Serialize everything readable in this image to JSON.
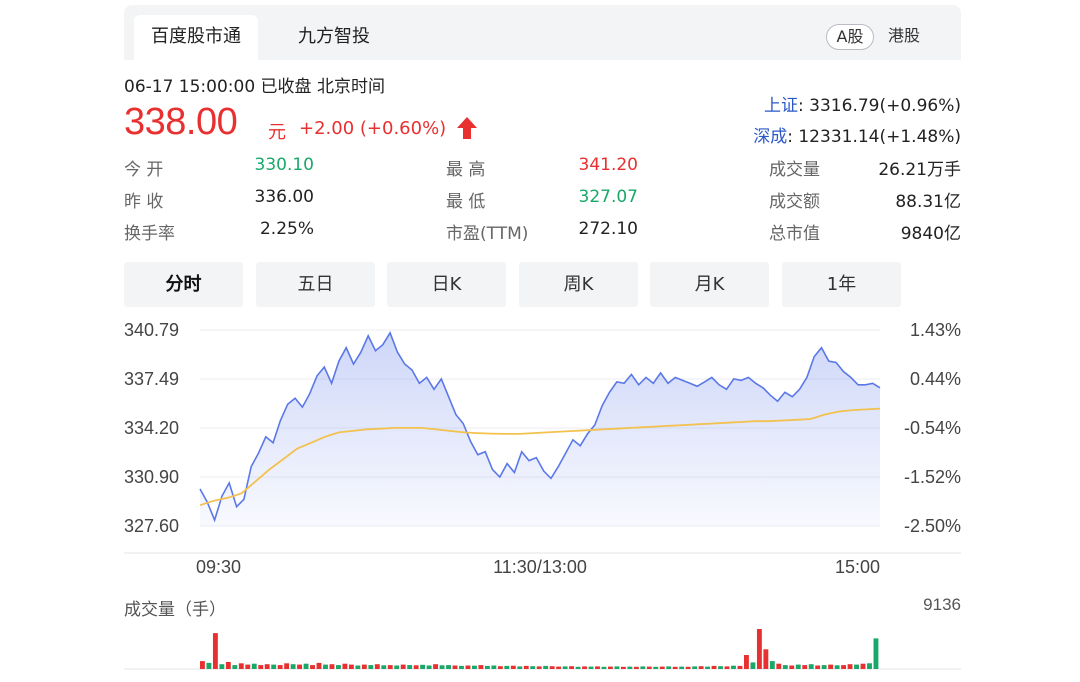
{
  "tabs": [
    {
      "label": "百度股市通"
    },
    {
      "label": "九方智投"
    }
  ],
  "markets": {
    "a": "A股",
    "hk": "港股"
  },
  "quote": {
    "timeline": "06-17 15:00:00  已收盘  北京时间",
    "price": "338.00",
    "unit": "元",
    "change": "+2.00 (+0.60%)",
    "direction": "up"
  },
  "indices": [
    {
      "name": "上证",
      "value": ": 3316.79(+0.96%)"
    },
    {
      "name": "深成",
      "value": ": 12331.14(+1.48%)"
    }
  ],
  "stats": {
    "open": {
      "label": "今  开",
      "value": "330.10"
    },
    "prev_close": {
      "label": "昨  收",
      "value": "336.00"
    },
    "turnover_rate": {
      "label": "换手率",
      "value": "2.25%"
    },
    "high": {
      "label": "最  高",
      "value": "341.20"
    },
    "low": {
      "label": "最  低",
      "value": "327.07"
    },
    "pe": {
      "label": "市盈(TTM)",
      "value": "272.10"
    },
    "volume": {
      "label": "成交量",
      "value": "26.21万手"
    },
    "amount": {
      "label": "成交额",
      "value": "88.31亿"
    },
    "market_cap": {
      "label": "总市值",
      "value": "9840亿"
    }
  },
  "periods": [
    "分时",
    "五日",
    "日K",
    "周K",
    "月K",
    "1年"
  ],
  "active_period": "分时",
  "colors": {
    "up": "#e93030",
    "down": "#1aa86a",
    "price_line": "#5b78e8",
    "avg_line": "#f2c14e",
    "index_name": "#2a59c8"
  },
  "volume_label": "成交量（手）",
  "volume_max": "9136",
  "chart_data": {
    "type": "area",
    "title": "",
    "x_ticks": [
      "09:30",
      "11:30/13:00",
      "15:00"
    ],
    "ylim": [
      327.6,
      340.79
    ],
    "y_ticks": [
      "340.79",
      "337.49",
      "334.20",
      "330.90",
      "327.60"
    ],
    "y2_ticks": [
      "1.43%",
      "0.44%",
      "-0.54%",
      "-1.52%",
      "-2.50%"
    ],
    "prev_close": 336.0,
    "series": [
      {
        "values": [
          330.1,
          329.2,
          328.0,
          329.6,
          330.5,
          328.9,
          329.4,
          331.6,
          332.5,
          333.6,
          333.2,
          334.7,
          335.8,
          336.2,
          335.6,
          336.5,
          337.7,
          338.3,
          337.2,
          338.7,
          339.6,
          338.5,
          339.3,
          340.4,
          339.4,
          339.8,
          340.6,
          339.3,
          338.5,
          338.1,
          337.2,
          337.6,
          336.8,
          337.5,
          336.3,
          335.1,
          334.5,
          333.3,
          332.4,
          332.6,
          331.4,
          330.9,
          331.8,
          331.2,
          332.6,
          332.0,
          332.2,
          331.3,
          330.8,
          331.6,
          332.5,
          333.4,
          333.0,
          333.8,
          334.4,
          335.7,
          336.6,
          337.3,
          337.2,
          337.8,
          337.1,
          337.6,
          337.2,
          337.9,
          337.2,
          337.6,
          337.4,
          337.2,
          337.0,
          337.3,
          337.6,
          337.1,
          336.8,
          337.5,
          337.4,
          337.6,
          337.2,
          336.9,
          336.4,
          336.0,
          336.6,
          336.3,
          336.8,
          337.6,
          339.0,
          339.6,
          338.7,
          338.6,
          338.0,
          337.6,
          337.1,
          337.1,
          337.2,
          336.9
        ]
      },
      {
        "values": [
          329.0,
          329.3,
          329.5,
          329.8,
          330.6,
          331.4,
          332.1,
          332.8,
          333.2,
          333.6,
          333.9,
          334.0,
          334.1,
          334.15,
          334.2,
          334.2,
          334.2,
          334.1,
          334.0,
          333.9,
          333.85,
          333.82,
          333.8,
          333.8,
          333.85,
          333.9,
          333.95,
          334.0,
          334.05,
          334.1,
          334.15,
          334.2,
          334.25,
          334.3,
          334.35,
          334.4,
          334.45,
          334.5,
          334.55,
          334.6,
          334.65,
          334.65,
          334.7,
          334.75,
          334.8,
          335.1,
          335.3,
          335.4,
          335.45,
          335.5
        ]
      }
    ],
    "volume": {
      "ylim": [
        0,
        9136
      ],
      "values": [
        1800,
        1400,
        8200,
        1100,
        1600,
        900,
        1300,
        1000,
        1200,
        900,
        1100,
        1000,
        900,
        1300,
        1100,
        1000,
        1200,
        900,
        1400,
        1000,
        1100,
        900,
        1200,
        1000,
        800,
        1000,
        900,
        1100,
        850,
        900,
        800,
        1000,
        900,
        850,
        950,
        800,
        1100,
        850,
        900,
        800,
        700,
        800,
        750,
        900,
        700,
        800,
        650,
        700,
        750,
        600,
        700,
        650,
        600,
        700,
        650,
        550,
        600,
        650,
        500,
        600,
        550,
        600,
        500,
        550,
        600,
        500,
        550,
        500,
        600,
        550,
        500,
        550,
        600,
        500,
        550,
        500,
        600,
        650,
        550,
        700,
        650,
        600,
        750,
        700,
        3200,
        1500,
        9136,
        4500,
        1800,
        1200,
        900,
        800,
        1000,
        900,
        1100,
        800,
        900,
        1000,
        850,
        900,
        1100,
        1000,
        1200,
        1300,
        7000
      ],
      "directions": [
        "u",
        "d",
        "u",
        "d",
        "u",
        "d",
        "u",
        "u",
        "d",
        "u",
        "u",
        "d",
        "u",
        "u",
        "d",
        "u",
        "d",
        "u",
        "u",
        "d",
        "u",
        "d",
        "u",
        "u",
        "d",
        "u",
        "d",
        "u",
        "d",
        "u",
        "d",
        "u",
        "d",
        "u",
        "d",
        "d",
        "u",
        "d",
        "d",
        "u",
        "d",
        "u",
        "d",
        "u",
        "d",
        "d",
        "u",
        "d",
        "u",
        "d",
        "u",
        "d",
        "u",
        "d",
        "u",
        "u",
        "d",
        "u",
        "d",
        "u",
        "d",
        "u",
        "d",
        "u",
        "d",
        "u",
        "d",
        "u",
        "d",
        "u",
        "d",
        "u",
        "d",
        "u",
        "d",
        "u",
        "d",
        "u",
        "d",
        "u",
        "d",
        "u",
        "d",
        "u",
        "u",
        "d",
        "u",
        "u",
        "d",
        "u",
        "d",
        "u",
        "d",
        "u",
        "d",
        "u",
        "d",
        "u",
        "d",
        "u",
        "u",
        "d",
        "u",
        "d",
        "d"
      ]
    }
  }
}
